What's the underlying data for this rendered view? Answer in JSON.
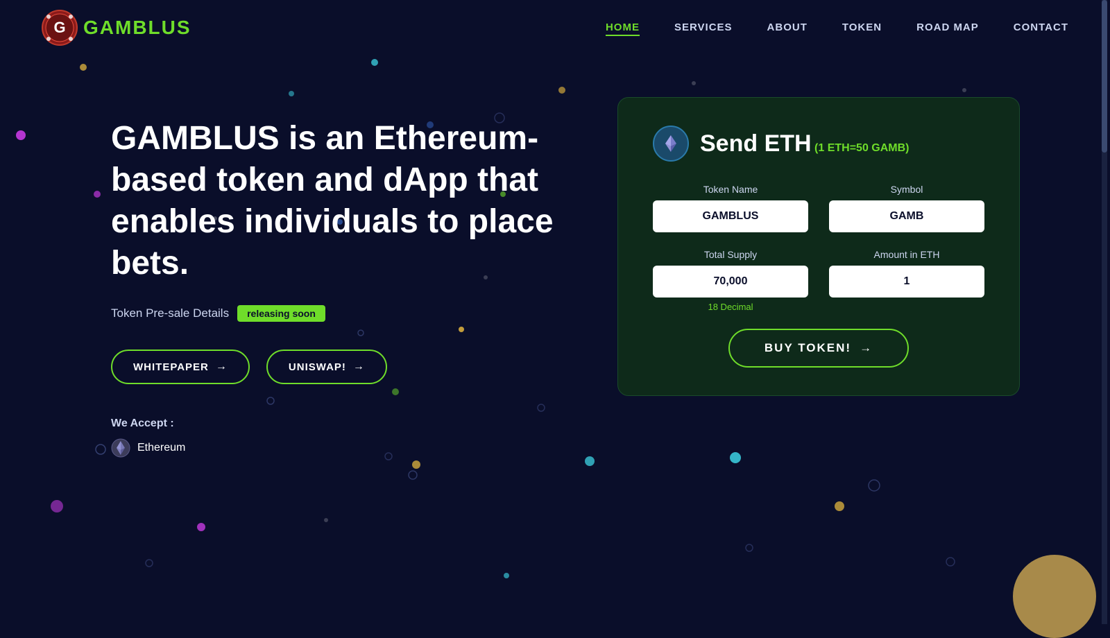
{
  "brand": {
    "name": "GAMBLUS",
    "logo_alt": "Gamblus Logo"
  },
  "nav": {
    "items": [
      {
        "label": "HOME",
        "active": true
      },
      {
        "label": "SERVICES",
        "active": false
      },
      {
        "label": "ABOUT",
        "active": false
      },
      {
        "label": "TOKEN",
        "active": false
      },
      {
        "label": "ROAD MAP",
        "active": false
      },
      {
        "label": "CONTACT",
        "active": false
      }
    ]
  },
  "hero": {
    "title_brand": "GAMBLUS",
    "title_rest": " is an Ethereum-based token and dApp that enables individuals to place bets.",
    "presale_label": "Token Pre-sale Details",
    "badge_text": "releasing soon",
    "btn_whitepaper": "WHITEPAPER",
    "btn_uniswap": "UNISWAP!",
    "accept_label": "We Accept :",
    "accept_item": "Ethereum"
  },
  "token_card": {
    "title": "Send ETH",
    "rate": "(1 ETH=50 GAMB)",
    "token_name_label": "Token Name",
    "token_name_value": "GAMBLUS",
    "symbol_label": "Symbol",
    "symbol_value": "GAMB",
    "total_supply_label": "Total Supply",
    "total_supply_value": "70,000",
    "amount_label": "Amount in ETH",
    "amount_value": "1",
    "decimal_hint": "18 Decimal",
    "buy_btn": "BUY TOKEN!"
  },
  "colors": {
    "accent": "#6fdd2a",
    "bg": "#0a0e2a",
    "card_bg": "#0e2a1a"
  }
}
